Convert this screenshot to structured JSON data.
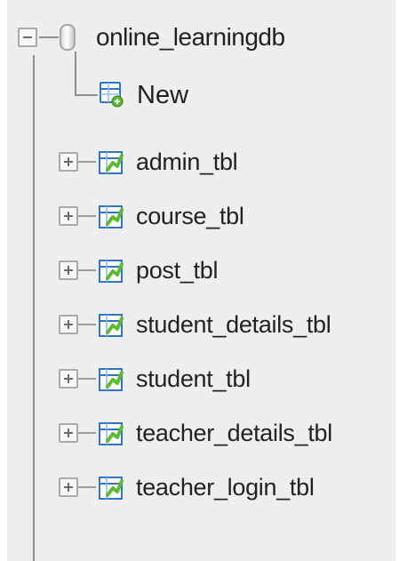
{
  "tree": {
    "database": {
      "name": "online_learningdb",
      "icon": "database-icon"
    },
    "new_item": {
      "label": "New",
      "icon": "new-table-icon"
    },
    "tables": [
      {
        "label": "admin_tbl",
        "icon": "table-icon"
      },
      {
        "label": "course_tbl",
        "icon": "table-icon"
      },
      {
        "label": "post_tbl",
        "icon": "table-icon"
      },
      {
        "label": "student_details_tbl",
        "icon": "table-icon"
      },
      {
        "label": "student_tbl",
        "icon": "table-icon"
      },
      {
        "label": "teacher_details_tbl",
        "icon": "table-icon"
      },
      {
        "label": "teacher_login_tbl",
        "icon": "table-icon"
      }
    ]
  },
  "colors": {
    "panel_background": "#eeeeee",
    "text": "#222222",
    "tree_line": "#8f8f8f",
    "icon_blue": "#2f74c8",
    "icon_green": "#5cbb2f"
  }
}
